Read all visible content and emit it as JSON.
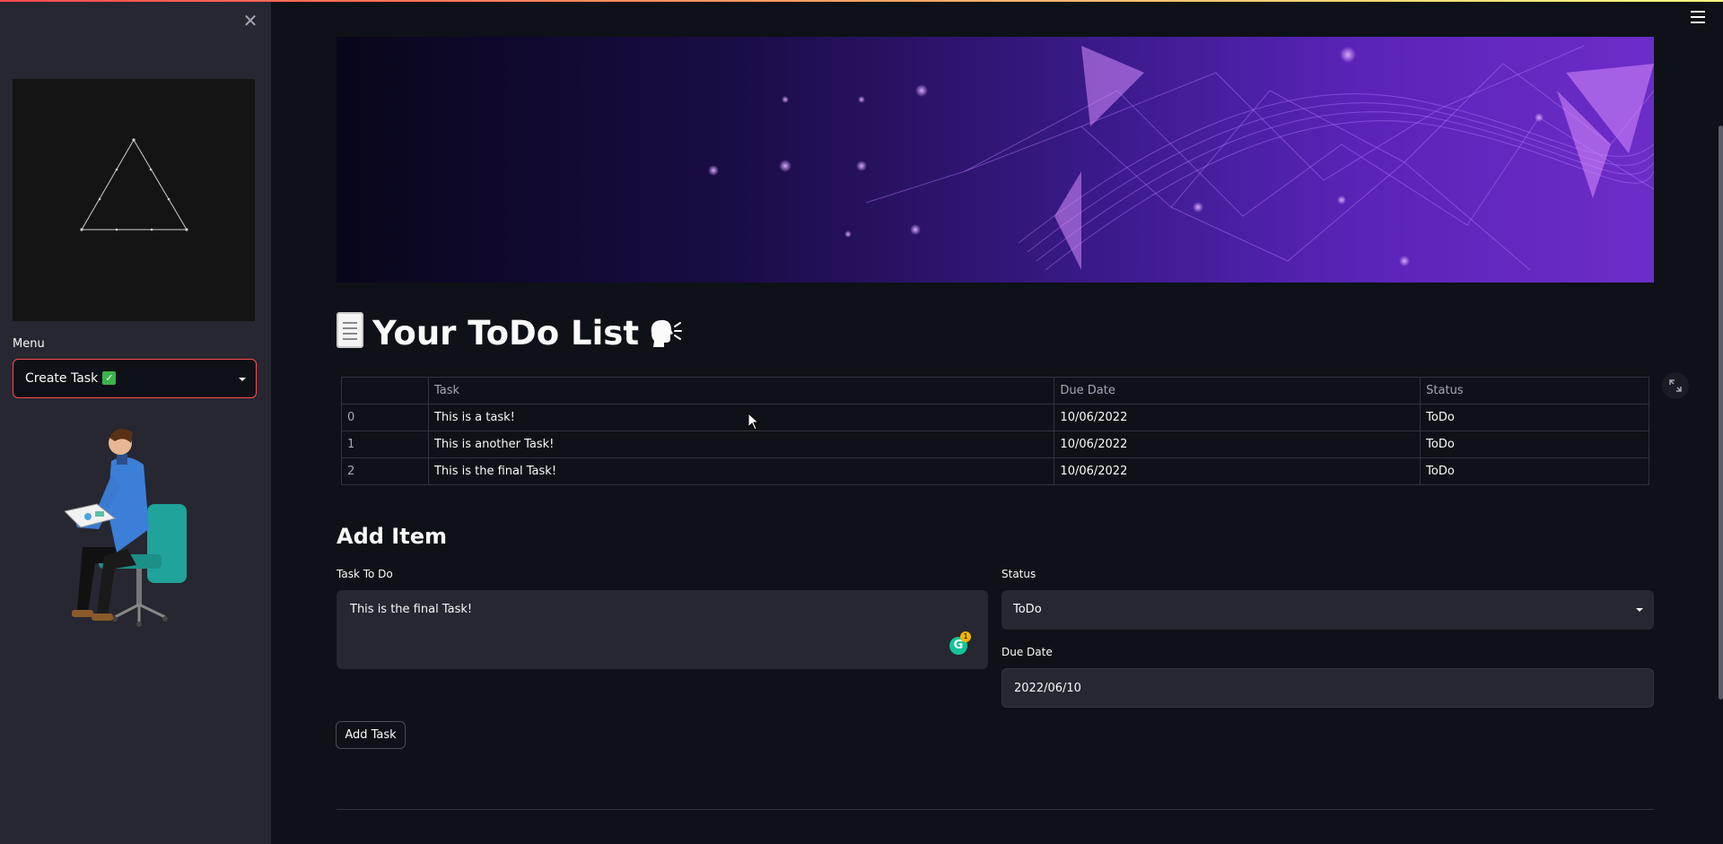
{
  "app": {
    "accent_color": "#ff4b4b",
    "background_color": "#0e1117",
    "sidebar_color": "#262730"
  },
  "sidebar": {
    "close_icon": "close-icon",
    "logo": "triangle-logo",
    "menu_label": "Menu",
    "menu_selected": "Create Task",
    "menu_selected_icon": "check-mark-icon",
    "illustration": "person-in-office-chair"
  },
  "header": {
    "menu_icon": "hamburger-icon",
    "banner": "purple-network-banner"
  },
  "main": {
    "title": "Your ToDo List",
    "title_icons": [
      "document-icon",
      "speaking-head-icon"
    ],
    "table": {
      "columns": [
        "",
        "Task",
        "Due Date",
        "Status"
      ],
      "rows": [
        {
          "index": "0",
          "task": "This is a task!",
          "due": "10/06/2022",
          "status": "ToDo"
        },
        {
          "index": "1",
          "task": "This is another Task!",
          "due": "10/06/2022",
          "status": "ToDo"
        },
        {
          "index": "2",
          "task": "This is the final Task!",
          "due": "10/06/2022",
          "status": "ToDo"
        }
      ]
    },
    "add_item": {
      "title": "Add Item",
      "task_label": "Task To Do",
      "task_value": "This is the final Task!",
      "grammarly_count": "1",
      "status_label": "Status",
      "status_value": "ToDo",
      "due_label": "Due Date",
      "due_value": "2022/06/10",
      "button": "Add Task"
    }
  }
}
